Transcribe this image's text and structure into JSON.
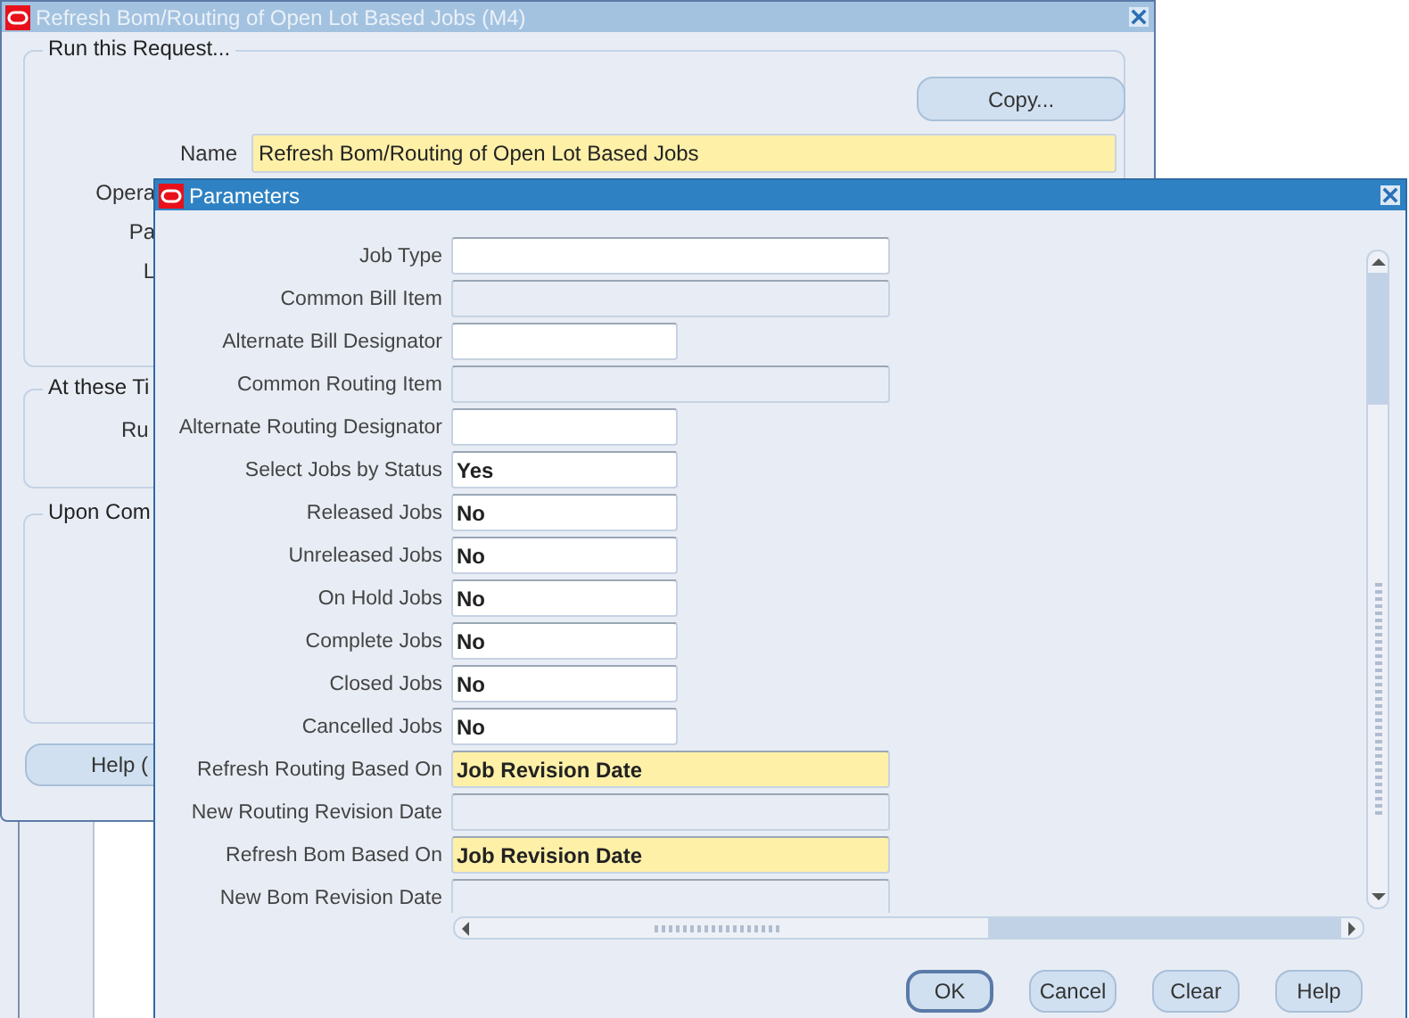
{
  "main_window": {
    "title": "Refresh Bom/Routing of Open Lot Based Jobs (M4)",
    "group_title": "Run this Request...",
    "copy_button": "Copy...",
    "name_label": "Name",
    "name_value": "Refresh Bom/Routing of Open Lot Based Jobs",
    "partial_labels": [
      "Opera",
      "Pa",
      "L"
    ],
    "schedule_group_title": "At these Ti",
    "schedule_label": "Ru",
    "completion_group_title": "Upon Com",
    "help_button": "Help ("
  },
  "dialog": {
    "title": "Parameters",
    "fields": [
      {
        "label": "Job Type",
        "kind": "text",
        "wide": true
      },
      {
        "label": "Common Bill Item",
        "kind": "readonly",
        "wide": true
      },
      {
        "label": "Alternate Bill Designator",
        "kind": "text",
        "wide": false
      },
      {
        "label": "Common Routing Item",
        "kind": "readonly",
        "wide": true
      },
      {
        "label": "Alternate Routing Designator",
        "kind": "text",
        "wide": false
      },
      {
        "label": "Select Jobs by Status",
        "kind": "text",
        "wide": false,
        "value": "Yes"
      },
      {
        "label": "Released Jobs",
        "kind": "text",
        "wide": false,
        "value": "No"
      },
      {
        "label": "Unreleased Jobs",
        "kind": "text",
        "wide": false,
        "value": "No"
      },
      {
        "label": "On Hold Jobs",
        "kind": "text",
        "wide": false,
        "value": "No"
      },
      {
        "label": "Complete Jobs",
        "kind": "text",
        "wide": false,
        "value": "No"
      },
      {
        "label": "Closed Jobs",
        "kind": "text",
        "wide": false,
        "value": "No"
      },
      {
        "label": "Cancelled Jobs",
        "kind": "text",
        "wide": false,
        "value": "No"
      },
      {
        "label": "Refresh Routing Based On",
        "kind": "required",
        "wide": true,
        "value": "Job Revision Date"
      },
      {
        "label": "New Routing Revision Date",
        "kind": "readonly",
        "wide": true
      },
      {
        "label": "Refresh Bom Based On",
        "kind": "required",
        "wide": true,
        "value": "Job Revision Date"
      },
      {
        "label": "New Bom Revision Date",
        "kind": "readonly",
        "wide": true
      }
    ],
    "buttons": [
      {
        "label": "OK",
        "default": true
      },
      {
        "label": "Cancel",
        "default": false
      },
      {
        "label": "Clear",
        "default": false
      },
      {
        "label": "Help",
        "default": false
      }
    ]
  }
}
